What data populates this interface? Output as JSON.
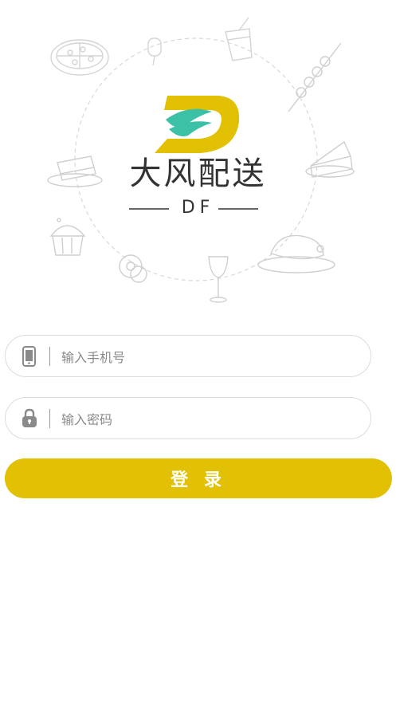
{
  "brand": {
    "name": "大风配送",
    "sub": "DF",
    "accent_yellow": "#e2c004",
    "accent_teal": "#3cc0a6"
  },
  "form": {
    "phone_placeholder": "输入手机号",
    "password_placeholder": "输入密码",
    "login_label": "登 录"
  },
  "icons": {
    "phone": "phone-icon",
    "lock": "lock-icon"
  }
}
